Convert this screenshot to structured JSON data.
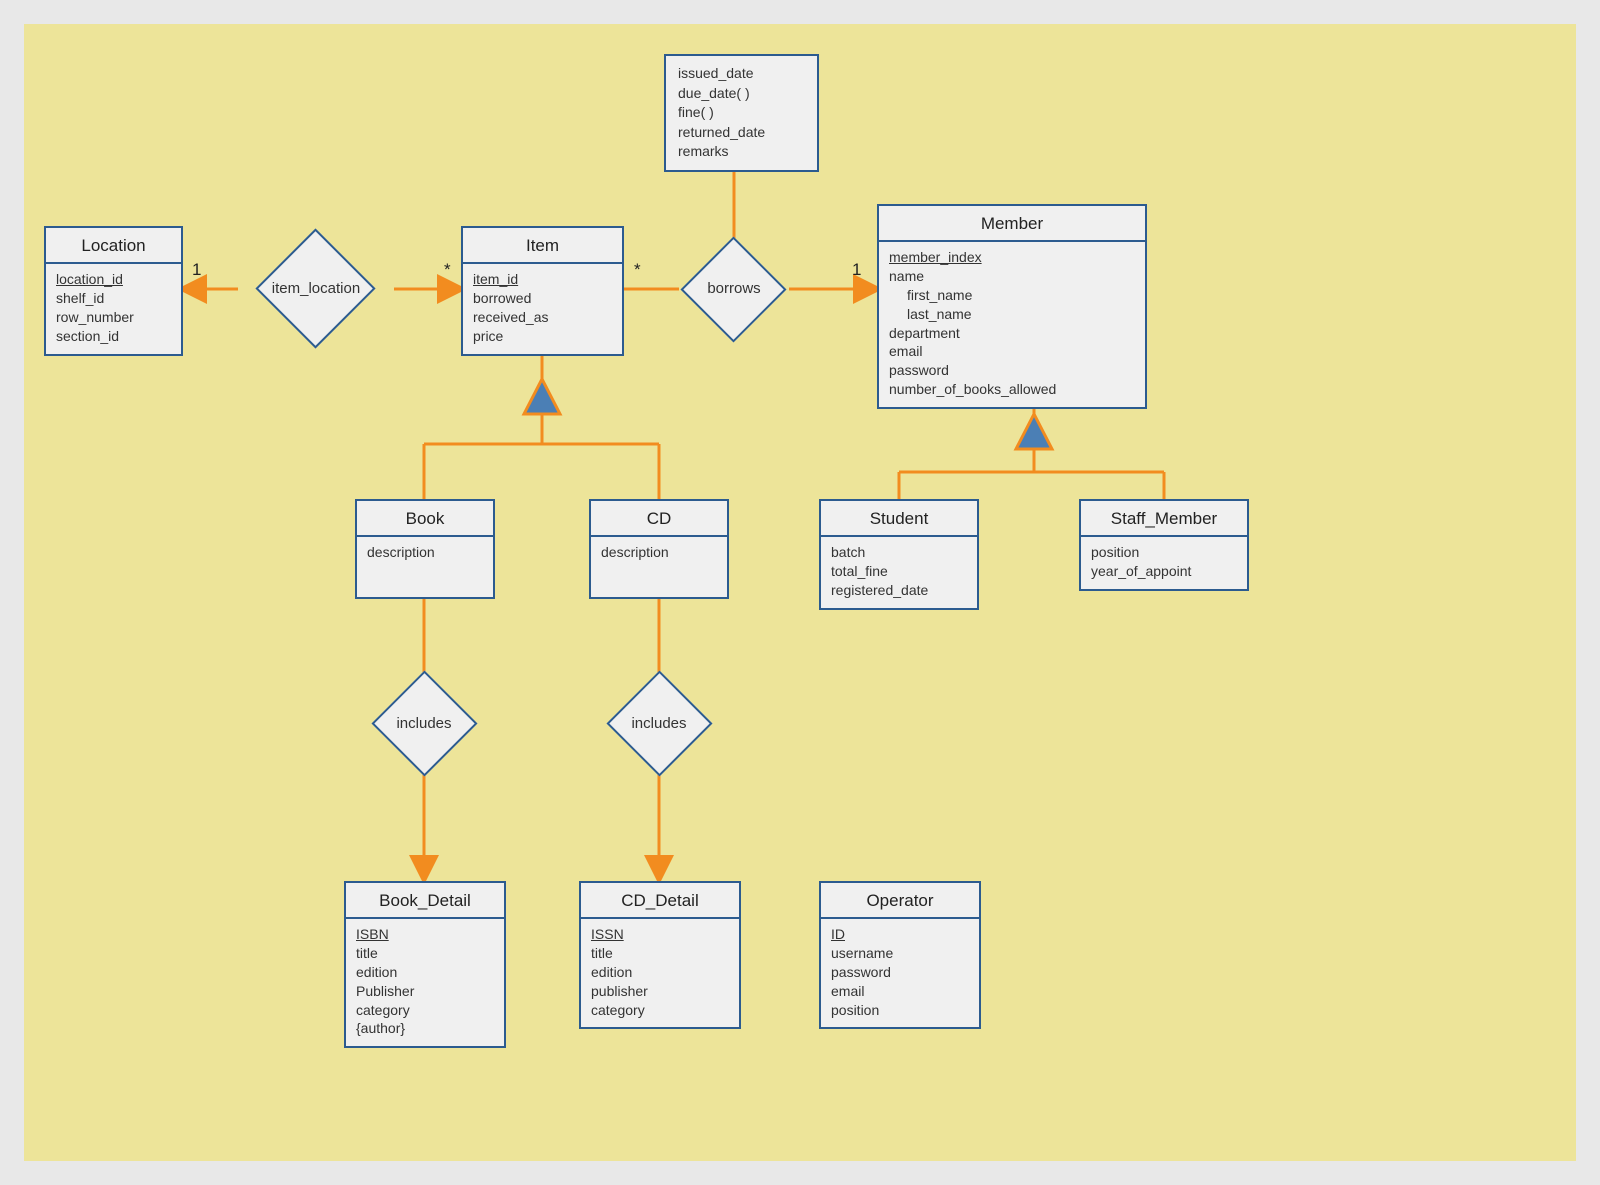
{
  "entities": {
    "location": {
      "title": "Location",
      "fields": [
        "location_id",
        "shelf_id",
        "row_number",
        "section_id"
      ],
      "keys": [
        "location_id"
      ]
    },
    "item": {
      "title": "Item",
      "fields": [
        "item_id",
        "borrowed",
        "received_as",
        "price"
      ],
      "keys": [
        "item_id"
      ]
    },
    "member": {
      "title": "Member",
      "fields": [
        "member_index",
        "name",
        "first_name",
        "last_name",
        "department",
        "email",
        "password",
        "number_of_books_allowed"
      ],
      "keys": [
        "member_index"
      ],
      "indented": [
        "first_name",
        "last_name"
      ]
    },
    "book": {
      "title": "Book",
      "fields": [
        "description"
      ]
    },
    "cd": {
      "title": "CD",
      "fields": [
        "description"
      ]
    },
    "student": {
      "title": "Student",
      "fields": [
        "batch",
        "total_fine",
        "registered_date"
      ]
    },
    "staff_member": {
      "title": "Staff_Member",
      "fields": [
        "position",
        "year_of_appoint"
      ]
    },
    "book_detail": {
      "title": "Book_Detail",
      "fields": [
        "ISBN",
        "title",
        "edition",
        "Publisher",
        "category",
        "{author}"
      ],
      "keys": [
        "ISBN"
      ]
    },
    "cd_detail": {
      "title": "CD_Detail",
      "fields": [
        "ISSN",
        "title",
        "edition",
        "publisher",
        "category"
      ],
      "keys": [
        "ISSN"
      ]
    },
    "operator": {
      "title": "Operator",
      "fields": [
        "ID",
        "username",
        "password",
        "email",
        "position"
      ],
      "keys": [
        "ID"
      ]
    }
  },
  "relationships": {
    "item_location": "item_location",
    "borrows": "borrows",
    "includes_book": "includes",
    "includes_cd": "includes"
  },
  "borrows_attrs": [
    "issued_date",
    "due_date( )",
    "fine( )",
    "returned_date",
    "remarks"
  ],
  "cardinalities": {
    "loc_one": "1",
    "item_star_left": "*",
    "item_star_right": "*",
    "member_one": "1"
  },
  "colors": {
    "border": "#2c5b8f",
    "line": "#f28c1f",
    "fill": "#f0f0f0",
    "triangle": "#4b7fb5"
  }
}
